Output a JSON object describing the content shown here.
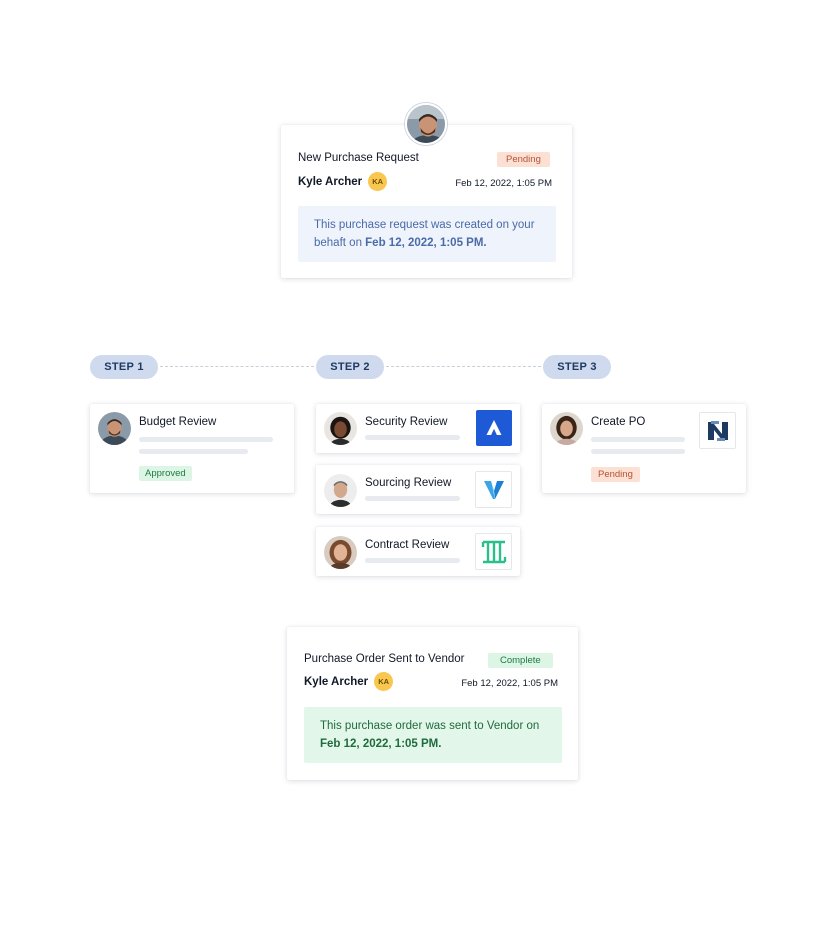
{
  "request_card": {
    "title": "New Purchase Request",
    "status": "Pending",
    "user_name": "Kyle Archer",
    "user_initials": "KA",
    "date": "Feb 12, 2022, 1:05 PM",
    "note_text": "This purchase request was created on your behaft on ",
    "note_date": "Feb 12, 2022, 1:05 PM."
  },
  "steps": [
    {
      "label": "STEP 1"
    },
    {
      "label": "STEP 2"
    },
    {
      "label": "STEP 3"
    }
  ],
  "reviews": {
    "budget": {
      "title": "Budget Review",
      "status": "Approved"
    },
    "security": {
      "title": "Security Review",
      "logo": "atlassian-logo"
    },
    "sourcing": {
      "title": "Sourcing Review",
      "logo": "v-logo"
    },
    "contract": {
      "title": "Contract Review",
      "logo": "ironclad-logo"
    },
    "create_po": {
      "title": "Create PO",
      "status": "Pending",
      "logo": "netsuite-logo"
    }
  },
  "order_card": {
    "title": "Purchase Order Sent to Vendor",
    "status": "Complete",
    "user_name": "Kyle Archer",
    "user_initials": "KA",
    "date": "Feb 12, 2022, 1:05 PM",
    "note_text": "This purchase order was sent to Vendor on ",
    "note_date": "Feb 12, 2022, 1:05 PM."
  },
  "colors": {
    "step_pill": "#cfdaee",
    "pending_bg": "#fde0d4",
    "complete_bg": "#dcf5e4",
    "info_note_bg": "#eef3fc",
    "success_note_bg": "#e2f6e9",
    "atlassian_blue": "#1f5ad6",
    "ironclad_green": "#2bbf8a",
    "netsuite_navy": "#1d3a63"
  }
}
